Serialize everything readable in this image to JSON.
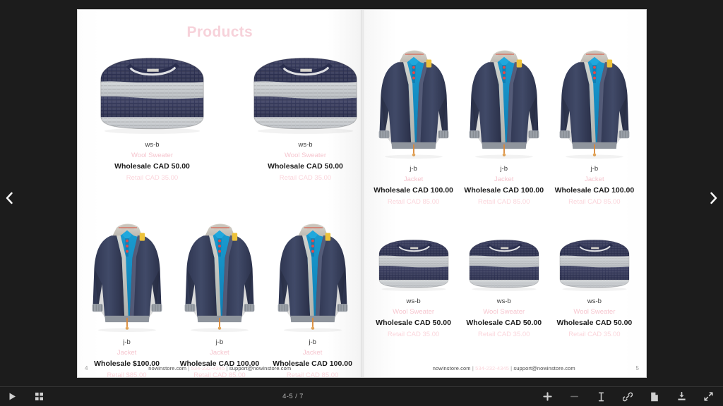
{
  "viewer": {
    "nav": {
      "prev_label": "‹",
      "prev_icon": "chevron-left-icon",
      "next_label": "›",
      "next_icon": "chevron-right-icon"
    },
    "toolbar": {
      "left": [
        {
          "name": "presentation-mode-button",
          "icon": "play-icon"
        },
        {
          "name": "thumbnails-button",
          "icon": "grid-icon"
        }
      ],
      "page_indicator": "4-5 / 7",
      "right": [
        {
          "name": "zoom-in-button",
          "icon": "plus-icon"
        },
        {
          "name": "zoom-out-button",
          "icon": "minus-icon"
        },
        {
          "name": "select-text-button",
          "icon": "text-cursor-icon"
        },
        {
          "name": "share-link-button",
          "icon": "link-icon"
        },
        {
          "name": "page-view-button",
          "icon": "page-icon"
        },
        {
          "name": "download-button",
          "icon": "download-icon"
        },
        {
          "name": "fullscreen-button",
          "icon": "expand-icon"
        }
      ]
    }
  },
  "colors": {
    "accent_pink": "#f6c6cf",
    "title_pink": "#f7d2da",
    "retail_pink": "#fbd6dc",
    "text_dark": "#1b1b1b",
    "chrome_dark": "#1c1c1c"
  },
  "catalog": {
    "title": "Products",
    "footer": {
      "website": "nowinstore.com",
      "separator": "|",
      "phone": "534-232-4345",
      "email": "support@nowinstore.com"
    },
    "left_page": {
      "number": "4",
      "rows": [
        {
          "type": "sweater",
          "items": [
            {
              "sku": "ws-b",
              "name": "Wool Sweater",
              "wholesale": "Wholesale CAD 50.00",
              "retail": "Retail CAD 35.00"
            },
            {
              "sku": "ws-b",
              "name": "Wool Sweater",
              "wholesale": "Wholesale CAD 50.00",
              "retail": "Retail CAD 35.00"
            }
          ]
        },
        {
          "type": "jacket",
          "items": [
            {
              "sku": "j-b",
              "name": "Jacket",
              "wholesale": "Wholesale $100.00",
              "retail": "Retail $85.00"
            },
            {
              "sku": "j-b",
              "name": "Jacket",
              "wholesale": "Wholesale CAD 100.00",
              "retail": "Retail CAD 85.00"
            },
            {
              "sku": "j-b",
              "name": "Jacket",
              "wholesale": "Wholesale CAD 100.00",
              "retail": "Retail CAD 85.00"
            }
          ]
        }
      ]
    },
    "right_page": {
      "number": "5",
      "rows": [
        {
          "type": "jacket",
          "items": [
            {
              "sku": "j-b",
              "name": "Jacket",
              "wholesale": "Wholesale CAD 100.00",
              "retail": "Retail CAD 85.00"
            },
            {
              "sku": "j-b",
              "name": "Jacket",
              "wholesale": "Wholesale CAD 100.00",
              "retail": "Retail CAD 85.00"
            },
            {
              "sku": "j-b",
              "name": "Jacket",
              "wholesale": "Wholesale CAD 100.00",
              "retail": "Retail CAD 85.00"
            }
          ]
        },
        {
          "type": "sweater",
          "items": [
            {
              "sku": "ws-b",
              "name": "Wool Sweater",
              "wholesale": "Wholesale CAD 50.00",
              "retail": "Retail CAD 35.00"
            },
            {
              "sku": "ws-b",
              "name": "Wool Sweater",
              "wholesale": "Wholesale CAD 50.00",
              "retail": "Retail CAD 35.00"
            },
            {
              "sku": "ws-b",
              "name": "Wool Sweater",
              "wholesale": "Wholesale CAD 50.00",
              "retail": "Retail CAD 35.00"
            }
          ]
        }
      ]
    }
  }
}
